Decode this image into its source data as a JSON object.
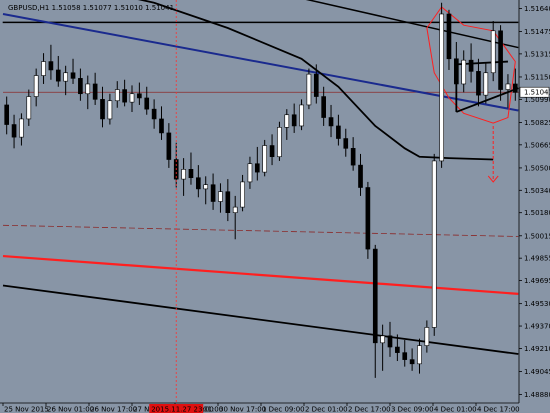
{
  "chart_data": {
    "type": "candlestick",
    "header": "GBPUSD,H1 1.51058 1.51077 1.51010 1.51041",
    "symbol": "GBPUSD",
    "timeframe": "H1",
    "ohlc": {
      "open": 1.51058,
      "high": 1.51077,
      "low": 1.5101,
      "close": 1.51041
    },
    "ylim": [
      1.4882,
      1.517
    ],
    "current_price": 1.51041,
    "y_ticks": [
      "1.51640",
      "1.51475",
      "1.51315",
      "1.51150",
      "1.50990",
      "1.50825",
      "1.50665",
      "1.50500",
      "1.50340",
      "1.50180",
      "1.50015",
      "1.49855",
      "1.49695",
      "1.49530",
      "1.49370",
      "1.49210",
      "1.49045",
      "1.48880"
    ],
    "x_ticks": [
      "25 Nov 2015",
      "26 Nov 01:00",
      "26 Nov 17:00",
      "27 Nov 09:00",
      "30 Nov 01:00",
      "30 Nov 17:00",
      "1 Dec 09:00",
      "2 Dec 01:00",
      "2 Dec 17:00",
      "3 Dec 09:00",
      "4 Dec 01:00",
      "4 Dec 17:00"
    ],
    "cursor_label": "2015.11.27 23:00",
    "axis_labels": {
      "x": "",
      "y": ""
    },
    "colors": {
      "background": "#8895a6",
      "candle": "#000000",
      "price_line": "#8b2a2a",
      "blue_trend": "#1a2a8e",
      "red_line": "#ff1f1f",
      "cursor": "#ff3030",
      "cursor_label_bg": "#e01010"
    },
    "candles": [
      {
        "t": 0,
        "o": 1.5095,
        "h": 1.5101,
        "l": 1.5074,
        "c": 1.5081
      },
      {
        "t": 1,
        "o": 1.5081,
        "h": 1.5088,
        "l": 1.5064,
        "c": 1.5072
      },
      {
        "t": 2,
        "o": 1.5072,
        "h": 1.5089,
        "l": 1.5066,
        "c": 1.5085
      },
      {
        "t": 3,
        "o": 1.5085,
        "h": 1.5106,
        "l": 1.508,
        "c": 1.5101
      },
      {
        "t": 4,
        "o": 1.5101,
        "h": 1.5121,
        "l": 1.5094,
        "c": 1.5116
      },
      {
        "t": 5,
        "o": 1.5116,
        "h": 1.5132,
        "l": 1.511,
        "c": 1.5126
      },
      {
        "t": 6,
        "o": 1.5126,
        "h": 1.5138,
        "l": 1.5113,
        "c": 1.512
      },
      {
        "t": 7,
        "o": 1.512,
        "h": 1.513,
        "l": 1.5108,
        "c": 1.5112
      },
      {
        "t": 8,
        "o": 1.5112,
        "h": 1.5123,
        "l": 1.5102,
        "c": 1.5118
      },
      {
        "t": 9,
        "o": 1.5118,
        "h": 1.5128,
        "l": 1.511,
        "c": 1.5114
      },
      {
        "t": 10,
        "o": 1.5114,
        "h": 1.5121,
        "l": 1.5098,
        "c": 1.5103
      },
      {
        "t": 11,
        "o": 1.5103,
        "h": 1.5116,
        "l": 1.5092,
        "c": 1.511
      },
      {
        "t": 12,
        "o": 1.511,
        "h": 1.5118,
        "l": 1.5095,
        "c": 1.5099
      },
      {
        "t": 13,
        "o": 1.5099,
        "h": 1.5108,
        "l": 1.5079,
        "c": 1.5085
      },
      {
        "t": 14,
        "o": 1.5085,
        "h": 1.5103,
        "l": 1.5081,
        "c": 1.5098
      },
      {
        "t": 15,
        "o": 1.5098,
        "h": 1.5112,
        "l": 1.5093,
        "c": 1.5106
      },
      {
        "t": 16,
        "o": 1.5106,
        "h": 1.5113,
        "l": 1.5094,
        "c": 1.5097
      },
      {
        "t": 17,
        "o": 1.5097,
        "h": 1.5109,
        "l": 1.509,
        "c": 1.5103
      },
      {
        "t": 18,
        "o": 1.5103,
        "h": 1.5111,
        "l": 1.5095,
        "c": 1.51
      },
      {
        "t": 19,
        "o": 1.51,
        "h": 1.5108,
        "l": 1.5088,
        "c": 1.5092
      },
      {
        "t": 20,
        "o": 1.5092,
        "h": 1.5099,
        "l": 1.5078,
        "c": 1.5085
      },
      {
        "t": 21,
        "o": 1.5085,
        "h": 1.5094,
        "l": 1.507,
        "c": 1.5075
      },
      {
        "t": 22,
        "o": 1.5075,
        "h": 1.5082,
        "l": 1.505,
        "c": 1.5056
      },
      {
        "t": 23,
        "o": 1.5056,
        "h": 1.5068,
        "l": 1.5036,
        "c": 1.5042
      },
      {
        "t": 24,
        "o": 1.5042,
        "h": 1.5057,
        "l": 1.503,
        "c": 1.5049
      },
      {
        "t": 25,
        "o": 1.5049,
        "h": 1.5061,
        "l": 1.5038,
        "c": 1.5043
      },
      {
        "t": 26,
        "o": 1.5043,
        "h": 1.5052,
        "l": 1.5029,
        "c": 1.5035
      },
      {
        "t": 27,
        "o": 1.5035,
        "h": 1.5044,
        "l": 1.5024,
        "c": 1.5038
      },
      {
        "t": 28,
        "o": 1.5038,
        "h": 1.5046,
        "l": 1.502,
        "c": 1.5026
      },
      {
        "t": 29,
        "o": 1.5026,
        "h": 1.5039,
        "l": 1.5018,
        "c": 1.5033
      },
      {
        "t": 30,
        "o": 1.5033,
        "h": 1.5042,
        "l": 1.5012,
        "c": 1.5018
      },
      {
        "t": 31,
        "o": 1.5018,
        "h": 1.503,
        "l": 1.4999,
        "c": 1.5022
      },
      {
        "t": 32,
        "o": 1.5022,
        "h": 1.5045,
        "l": 1.5019,
        "c": 1.504
      },
      {
        "t": 33,
        "o": 1.504,
        "h": 1.5058,
        "l": 1.5035,
        "c": 1.5053
      },
      {
        "t": 34,
        "o": 1.5053,
        "h": 1.5065,
        "l": 1.5041,
        "c": 1.5047
      },
      {
        "t": 35,
        "o": 1.5047,
        "h": 1.507,
        "l": 1.5044,
        "c": 1.5066
      },
      {
        "t": 36,
        "o": 1.5066,
        "h": 1.5074,
        "l": 1.5052,
        "c": 1.5058
      },
      {
        "t": 37,
        "o": 1.5058,
        "h": 1.5083,
        "l": 1.5055,
        "c": 1.5079
      },
      {
        "t": 38,
        "o": 1.5079,
        "h": 1.5092,
        "l": 1.507,
        "c": 1.5088
      },
      {
        "t": 39,
        "o": 1.5088,
        "h": 1.5096,
        "l": 1.5075,
        "c": 1.508
      },
      {
        "t": 40,
        "o": 1.508,
        "h": 1.5099,
        "l": 1.5077,
        "c": 1.5095
      },
      {
        "t": 41,
        "o": 1.5095,
        "h": 1.5121,
        "l": 1.5092,
        "c": 1.5117
      },
      {
        "t": 42,
        "o": 1.5117,
        "h": 1.5124,
        "l": 1.5096,
        "c": 1.5101
      },
      {
        "t": 43,
        "o": 1.5101,
        "h": 1.5108,
        "l": 1.508,
        "c": 1.5086
      },
      {
        "t": 44,
        "o": 1.5086,
        "h": 1.5095,
        "l": 1.5072,
        "c": 1.508
      },
      {
        "t": 45,
        "o": 1.508,
        "h": 1.5088,
        "l": 1.5066,
        "c": 1.5071
      },
      {
        "t": 46,
        "o": 1.5071,
        "h": 1.5078,
        "l": 1.5058,
        "c": 1.5064
      },
      {
        "t": 47,
        "o": 1.5064,
        "h": 1.5072,
        "l": 1.5048,
        "c": 1.5052
      },
      {
        "t": 48,
        "o": 1.5052,
        "h": 1.506,
        "l": 1.503,
        "c": 1.5036
      },
      {
        "t": 49,
        "o": 1.5036,
        "h": 1.504,
        "l": 1.4985,
        "c": 1.4992
      },
      {
        "t": 50,
        "o": 1.4992,
        "h": 1.4995,
        "l": 1.49,
        "c": 1.4925
      },
      {
        "t": 51,
        "o": 1.4925,
        "h": 1.4938,
        "l": 1.4905,
        "c": 1.493
      },
      {
        "t": 52,
        "o": 1.493,
        "h": 1.494,
        "l": 1.4915,
        "c": 1.4922
      },
      {
        "t": 53,
        "o": 1.4922,
        "h": 1.4931,
        "l": 1.4912,
        "c": 1.4918
      },
      {
        "t": 54,
        "o": 1.4918,
        "h": 1.4927,
        "l": 1.4908,
        "c": 1.4913
      },
      {
        "t": 55,
        "o": 1.4913,
        "h": 1.4921,
        "l": 1.4905,
        "c": 1.491
      },
      {
        "t": 56,
        "o": 1.491,
        "h": 1.4928,
        "l": 1.4903,
        "c": 1.4923
      },
      {
        "t": 57,
        "o": 1.4923,
        "h": 1.4941,
        "l": 1.4918,
        "c": 1.4936
      },
      {
        "t": 58,
        "o": 1.4936,
        "h": 1.506,
        "l": 1.493,
        "c": 1.5055
      },
      {
        "t": 59,
        "o": 1.5055,
        "h": 1.5168,
        "l": 1.505,
        "c": 1.516
      },
      {
        "t": 60,
        "o": 1.516,
        "h": 1.5163,
        "l": 1.512,
        "c": 1.5128
      },
      {
        "t": 61,
        "o": 1.5128,
        "h": 1.514,
        "l": 1.5102,
        "c": 1.511
      },
      {
        "t": 62,
        "o": 1.511,
        "h": 1.5134,
        "l": 1.5104,
        "c": 1.5127
      },
      {
        "t": 63,
        "o": 1.5127,
        "h": 1.5139,
        "l": 1.5111,
        "c": 1.5119
      },
      {
        "t": 64,
        "o": 1.5119,
        "h": 1.5128,
        "l": 1.5094,
        "c": 1.5102
      },
      {
        "t": 65,
        "o": 1.5102,
        "h": 1.5125,
        "l": 1.5096,
        "c": 1.5118
      },
      {
        "t": 66,
        "o": 1.5118,
        "h": 1.5155,
        "l": 1.5112,
        "c": 1.5148
      },
      {
        "t": 67,
        "o": 1.5148,
        "h": 1.5152,
        "l": 1.5098,
        "c": 1.5106
      },
      {
        "t": 68,
        "o": 1.5106,
        "h": 1.5117,
        "l": 1.5093,
        "c": 1.511
      },
      {
        "t": 69,
        "o": 1.511,
        "h": 1.5121,
        "l": 1.5098,
        "c": 1.5104
      }
    ],
    "annotations": {
      "black_h_line": {
        "x0": 0,
        "x1": 69,
        "y": 1.5154
      },
      "black_top_trend": {
        "x0": 26,
        "x1": 69,
        "y0": 1.5188,
        "y1": 1.5136
      },
      "blue_trend": {
        "x0": 0,
        "x1": 69,
        "y0": 1.516,
        "y1": 1.5091
      },
      "moving_average": [
        {
          "x": 10,
          "y": 1.518
        },
        {
          "x": 20,
          "y": 1.5168
        },
        {
          "x": 30,
          "y": 1.515
        },
        {
          "x": 40,
          "y": 1.5128
        },
        {
          "x": 45,
          "y": 1.5108
        },
        {
          "x": 50,
          "y": 1.508
        },
        {
          "x": 54,
          "y": 1.5064
        },
        {
          "x": 56,
          "y": 1.5058
        },
        {
          "x": 60,
          "y": 1.5057
        },
        {
          "x": 66,
          "y": 1.5056
        }
      ],
      "black_lower_trend": {
        "x0": 0,
        "x1": 69,
        "y0": 1.4966,
        "y1": 1.4917
      },
      "red_line": {
        "x0": 0,
        "x1": 69,
        "y0": 1.4987,
        "y1": 1.496
      },
      "dashed_red_line": {
        "x0": 0,
        "x1": 69,
        "y0": 1.5009,
        "y1": 1.5001
      },
      "triangle": [
        {
          "x": 61,
          "y": 1.5124
        },
        {
          "x": 68,
          "y": 1.5126
        },
        {
          "x": 61,
          "y": 1.509
        },
        {
          "x": 69,
          "y": 1.5107
        }
      ],
      "red_curve": [
        {
          "x": 57,
          "y": 1.515
        },
        {
          "x": 59,
          "y": 1.5165
        },
        {
          "x": 62,
          "y": 1.5152
        },
        {
          "x": 66,
          "y": 1.5148
        },
        {
          "x": 69,
          "y": 1.5126
        },
        {
          "x": 68,
          "y": 1.5086
        },
        {
          "x": 66,
          "y": 1.5082
        },
        {
          "x": 62,
          "y": 1.5089
        },
        {
          "x": 60,
          "y": 1.51
        },
        {
          "x": 58,
          "y": 1.5118
        },
        {
          "x": 57,
          "y": 1.515
        }
      ],
      "red_arrow": [
        {
          "x": 66,
          "y": 1.508
        },
        {
          "x": 66,
          "y": 1.504
        }
      ],
      "cursor_t": 23
    }
  }
}
